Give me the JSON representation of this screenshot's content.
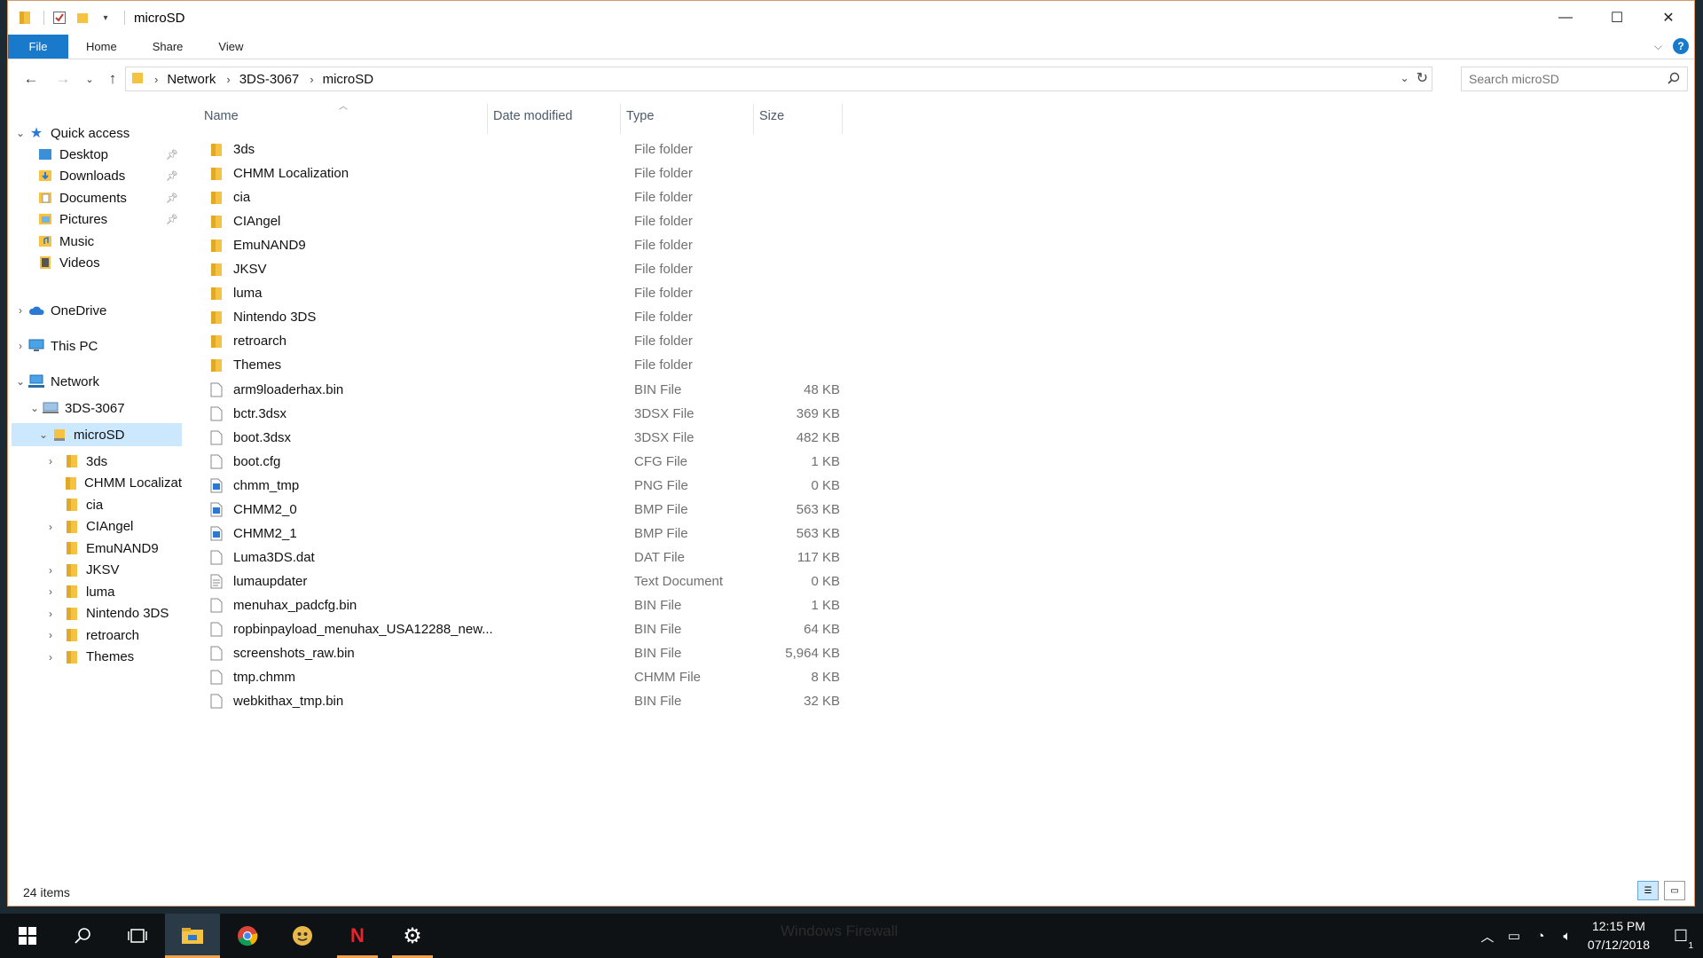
{
  "window": {
    "title": "microSD",
    "controls": {
      "minimize": "—",
      "maximize": "☐",
      "close": "✕"
    }
  },
  "ribbon": {
    "tabs": [
      "File",
      "Home",
      "Share",
      "View"
    ],
    "help": "?"
  },
  "address": {
    "crumbs": [
      "Network",
      "3DS-3067",
      "microSD"
    ]
  },
  "search": {
    "placeholder": "Search microSD"
  },
  "navpane": {
    "quick_access": "Quick access",
    "quick_items": [
      {
        "label": "Desktop",
        "icon": "desktop-icon"
      },
      {
        "label": "Downloads",
        "icon": "downloads-icon"
      },
      {
        "label": "Documents",
        "icon": "documents-icon"
      },
      {
        "label": "Pictures",
        "icon": "pictures-icon"
      },
      {
        "label": "Music",
        "icon": "music-icon"
      },
      {
        "label": "Videos",
        "icon": "videos-icon"
      }
    ],
    "onedrive": "OneDrive",
    "thispc": "This PC",
    "network": "Network",
    "device": "3DS-3067",
    "drive": "microSD",
    "drive_children": [
      "3ds",
      "CHMM Localizat",
      "cia",
      "CIAngel",
      "EmuNAND9",
      "JKSV",
      "luma",
      "Nintendo 3DS",
      "retroarch",
      "Themes"
    ]
  },
  "columns": {
    "name": "Name",
    "date": "Date modified",
    "type": "Type",
    "size": "Size"
  },
  "files": [
    {
      "name": "3ds",
      "type": "File folder",
      "size": "",
      "icon": "folder"
    },
    {
      "name": "CHMM Localization",
      "type": "File folder",
      "size": "",
      "icon": "folder"
    },
    {
      "name": "cia",
      "type": "File folder",
      "size": "",
      "icon": "folder"
    },
    {
      "name": "CIAngel",
      "type": "File folder",
      "size": "",
      "icon": "folder"
    },
    {
      "name": "EmuNAND9",
      "type": "File folder",
      "size": "",
      "icon": "folder"
    },
    {
      "name": "JKSV",
      "type": "File folder",
      "size": "",
      "icon": "folder"
    },
    {
      "name": "luma",
      "type": "File folder",
      "size": "",
      "icon": "folder"
    },
    {
      "name": "Nintendo 3DS",
      "type": "File folder",
      "size": "",
      "icon": "folder"
    },
    {
      "name": "retroarch",
      "type": "File folder",
      "size": "",
      "icon": "folder"
    },
    {
      "name": "Themes",
      "type": "File folder",
      "size": "",
      "icon": "folder"
    },
    {
      "name": "arm9loaderhax.bin",
      "type": "BIN File",
      "size": "48 KB",
      "icon": "file"
    },
    {
      "name": "bctr.3dsx",
      "type": "3DSX File",
      "size": "369 KB",
      "icon": "file"
    },
    {
      "name": "boot.3dsx",
      "type": "3DSX File",
      "size": "482 KB",
      "icon": "file"
    },
    {
      "name": "boot.cfg",
      "type": "CFG File",
      "size": "1 KB",
      "icon": "file"
    },
    {
      "name": "chmm_tmp",
      "type": "PNG File",
      "size": "0 KB",
      "icon": "image"
    },
    {
      "name": "CHMM2_0",
      "type": "BMP File",
      "size": "563 KB",
      "icon": "image"
    },
    {
      "name": "CHMM2_1",
      "type": "BMP File",
      "size": "563 KB",
      "icon": "image"
    },
    {
      "name": "Luma3DS.dat",
      "type": "DAT File",
      "size": "117 KB",
      "icon": "file"
    },
    {
      "name": "lumaupdater",
      "type": "Text Document",
      "size": "0 KB",
      "icon": "text"
    },
    {
      "name": "menuhax_padcfg.bin",
      "type": "BIN File",
      "size": "1 KB",
      "icon": "file"
    },
    {
      "name": "ropbinpayload_menuhax_USA12288_new...",
      "type": "BIN File",
      "size": "64 KB",
      "icon": "file"
    },
    {
      "name": "screenshots_raw.bin",
      "type": "BIN File",
      "size": "5,964 KB",
      "icon": "file"
    },
    {
      "name": "tmp.chmm",
      "type": "CHMM File",
      "size": "8 KB",
      "icon": "file"
    },
    {
      "name": "webkithax_tmp.bin",
      "type": "BIN File",
      "size": "32 KB",
      "icon": "file"
    }
  ],
  "status": {
    "count": "24 items"
  },
  "taskbar": {
    "window_title": "Windows Firewall",
    "time": "12:15 PM",
    "date": "07/12/2018",
    "notification_count": "1"
  },
  "colors": {
    "accent": "#1979ca",
    "folder": "#f5c242",
    "selection": "#cce8ff"
  }
}
